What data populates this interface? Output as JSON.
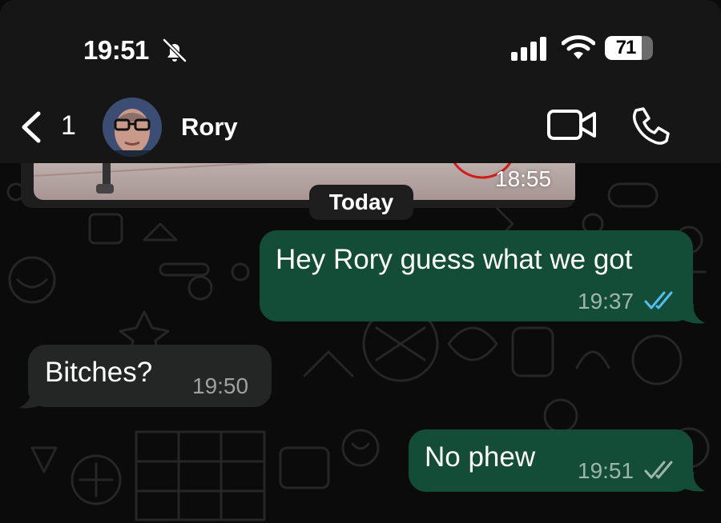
{
  "status_bar": {
    "time": "19:51",
    "battery": "71",
    "icons": [
      "bell-slash-icon",
      "cellular-signal-icon",
      "wifi-icon",
      "battery-icon"
    ]
  },
  "header": {
    "back_count": "1",
    "contact_name": "Rory",
    "icons": [
      "chevron-left-icon",
      "video-camera-icon",
      "phone-icon"
    ]
  },
  "chat": {
    "previous_media_time": "18:55",
    "date_separator": "Today",
    "messages": [
      {
        "direction": "outgoing",
        "text": "Hey Rory guess what we got",
        "time": "19:37",
        "status": "read"
      },
      {
        "direction": "incoming",
        "text": "Bitches?",
        "time": "19:50"
      },
      {
        "direction": "outgoing",
        "text": "No phew",
        "time": "19:51",
        "status": "delivered"
      }
    ]
  },
  "colors": {
    "outgoing_bubble": "#134d37",
    "incoming_bubble": "#242626",
    "read_tick": "#53bdeb",
    "delivered_tick": "#9fb5aa",
    "header_bg": "#161616"
  }
}
